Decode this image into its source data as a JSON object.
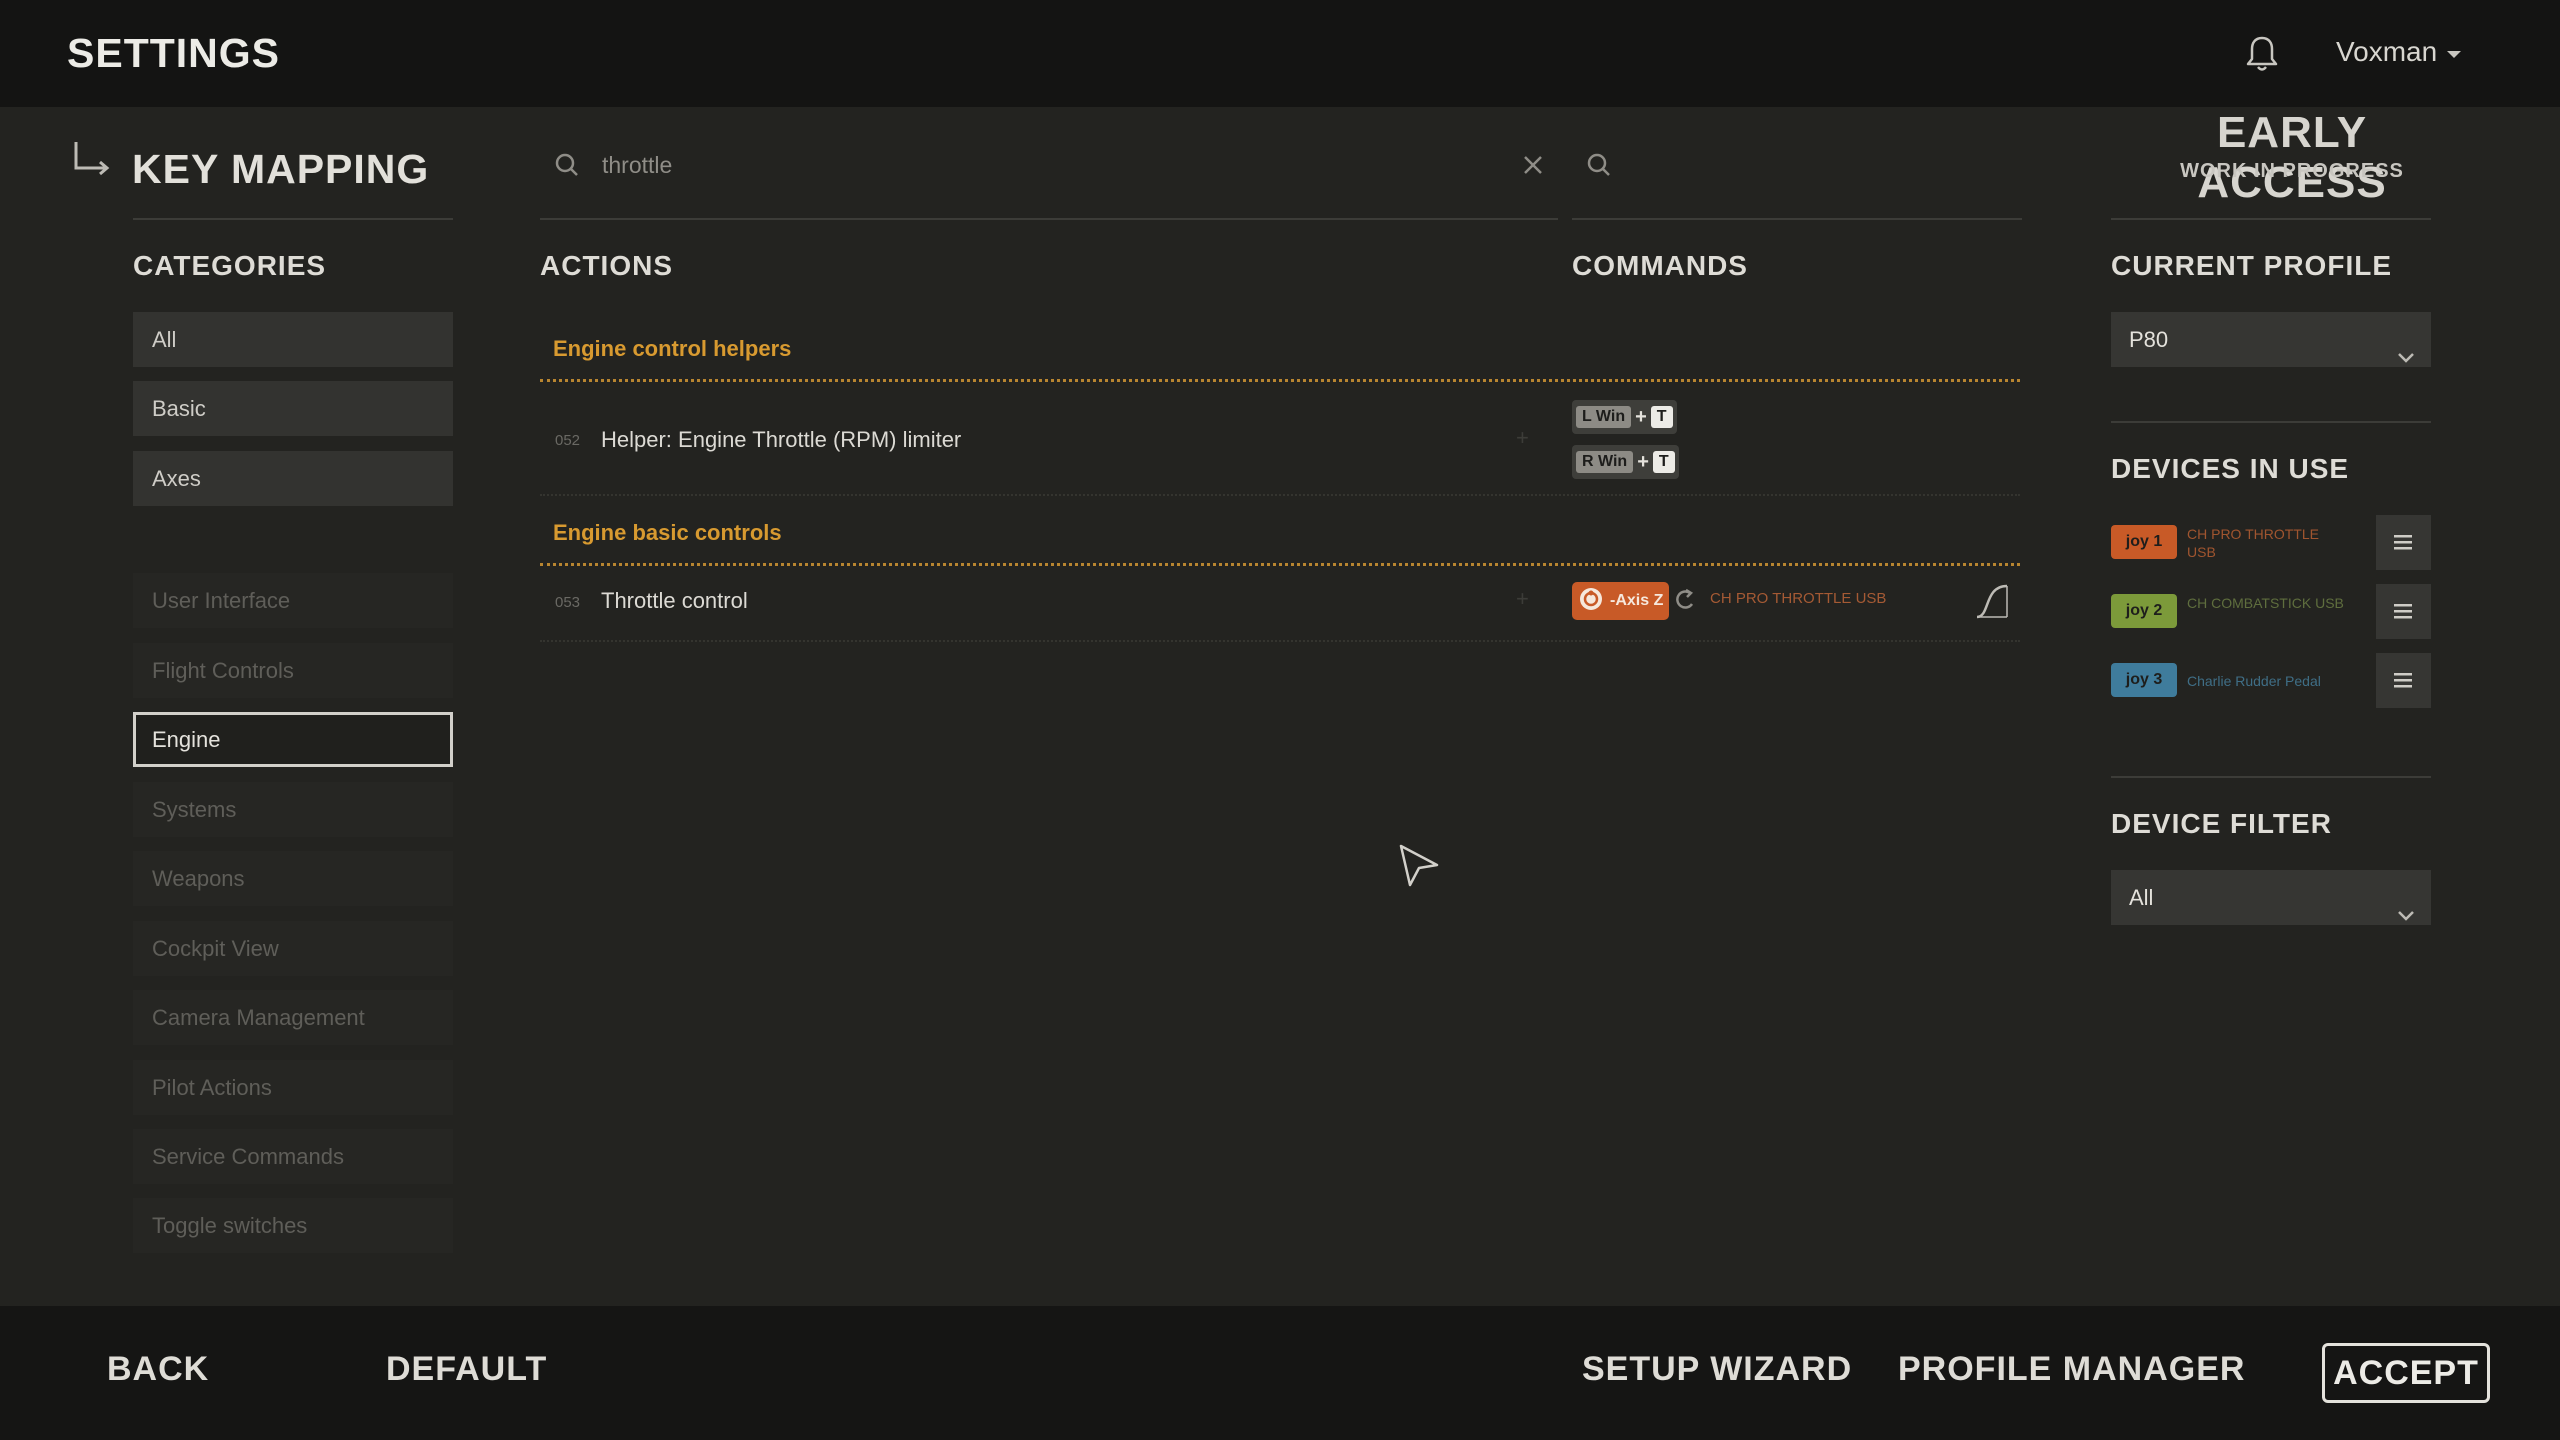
{
  "header": {
    "title": "SETTINGS",
    "username": "Voxman"
  },
  "key_mapping": {
    "title": "KEY MAPPING"
  },
  "search": {
    "query": "throttle",
    "commands_query": ""
  },
  "badge": {
    "title": "EARLY ACCESS",
    "subtitle": "WORK IN PROGRESS"
  },
  "categories": {
    "heading": "CATEGORIES",
    "items": [
      {
        "label": "All"
      },
      {
        "label": "Basic"
      },
      {
        "label": "Axes"
      },
      {
        "label": "User Interface"
      },
      {
        "label": "Flight Controls"
      },
      {
        "label": "Engine"
      },
      {
        "label": "Systems"
      },
      {
        "label": "Weapons"
      },
      {
        "label": "Cockpit View"
      },
      {
        "label": "Camera Management"
      },
      {
        "label": "Pilot Actions"
      },
      {
        "label": "Service Commands"
      },
      {
        "label": "Toggle switches"
      }
    ],
    "selected": "Engine"
  },
  "actions": {
    "heading": "ACTIONS",
    "groups": [
      {
        "title": "Engine control helpers",
        "rows": [
          {
            "num": "052",
            "label": "Helper: Engine Throttle (RPM) limiter"
          }
        ]
      },
      {
        "title": "Engine basic controls",
        "rows": [
          {
            "num": "053",
            "label": "Throttle control"
          }
        ]
      }
    ]
  },
  "commands": {
    "heading": "COMMANDS",
    "bindings": [
      {
        "modifier": "L Win",
        "plus": "+",
        "key": "T"
      },
      {
        "modifier": "R Win",
        "plus": "+",
        "key": "T"
      }
    ],
    "axis": {
      "label": "-Axis Z",
      "device": "CH PRO THROTTLE USB"
    }
  },
  "profile": {
    "heading": "CURRENT PROFILE",
    "value": "P80"
  },
  "devices": {
    "heading": "DEVICES IN USE",
    "items": [
      {
        "badge": "joy 1",
        "name": "CH PRO THROTTLE USB",
        "color": "#c85a27",
        "text_color": "#a0552f"
      },
      {
        "badge": "joy 2",
        "name": "CH COMBATSTICK USB",
        "color": "#7c9a3a",
        "text_color": "#5f6e3e"
      },
      {
        "badge": "joy 3",
        "name": "Charlie Rudder Pedal",
        "color": "#3f7c9c",
        "text_color": "#3f6e86"
      }
    ]
  },
  "device_filter": {
    "heading": "DEVICE FILTER",
    "value": "All"
  },
  "footer": {
    "back": "BACK",
    "default": "DEFAULT",
    "setup_wizard": "SETUP WIZARD",
    "profile_manager": "PROFILE MANAGER",
    "accept": "ACCEPT"
  },
  "colors": {
    "accent": "#d89a30",
    "background": "#232320",
    "bar": "#141413"
  }
}
